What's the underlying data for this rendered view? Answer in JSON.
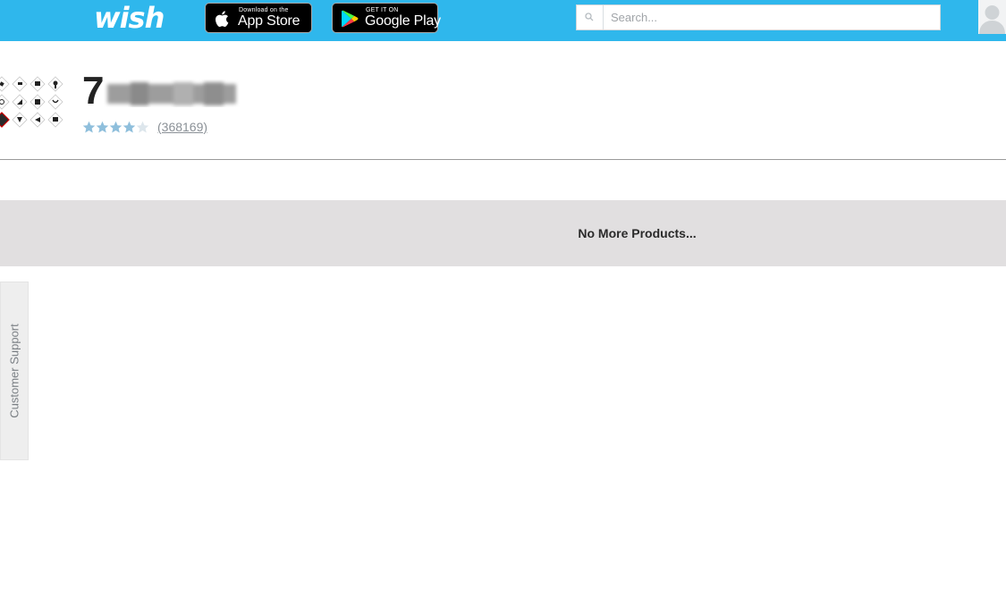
{
  "header": {
    "logo_text": "wish",
    "app_store": {
      "small": "Download on the",
      "big": "App Store"
    },
    "google_play": {
      "small": "GET IT ON",
      "big": "Google Play"
    },
    "search": {
      "placeholder": "Search...",
      "value": ""
    }
  },
  "store": {
    "name": "7",
    "rating_stars": 4,
    "rating_count": "(368169)"
  },
  "status": {
    "no_more_products": "No More Products..."
  },
  "support_tab": {
    "label": "Customer Support"
  },
  "colors": {
    "header_bg": "#2fb7ec",
    "star_filled": "#8fbfdc",
    "star_empty": "#dde6ec",
    "banner_bg": "#e1dfe0"
  }
}
